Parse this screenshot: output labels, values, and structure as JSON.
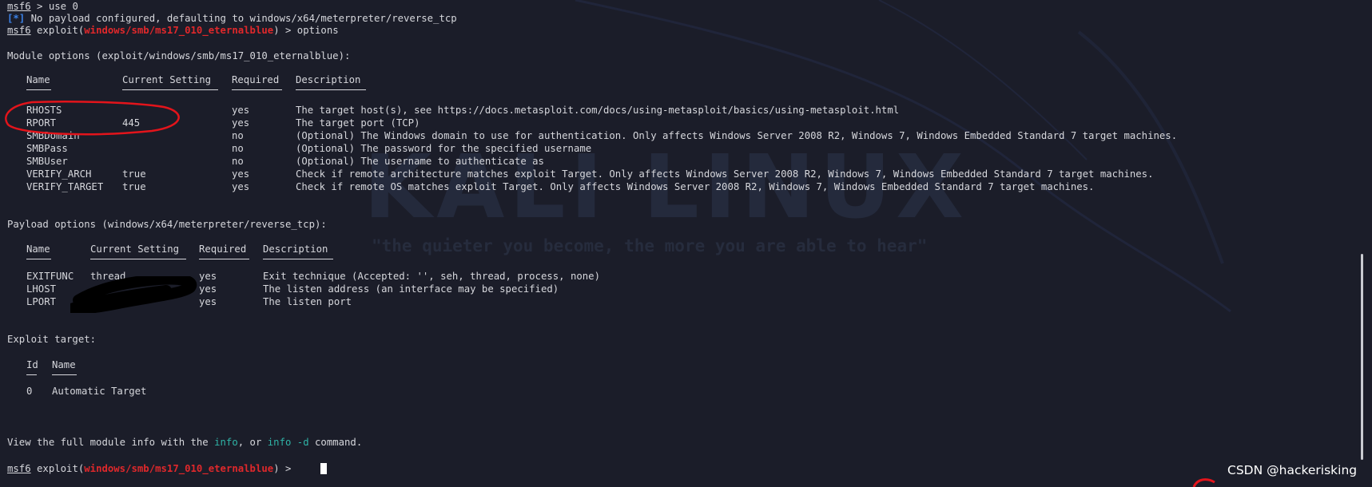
{
  "watermark": {
    "logo": "KALI LINUX",
    "quote": "\"the quieter you become, the more you are able to hear\""
  },
  "lines": {
    "l1_prompt": "msf6",
    "l1_cmd": " > use 0",
    "l2_tag": "[*]",
    "l2_text": " No payload configured, defaulting to windows/x64/meterpreter/reverse_tcp",
    "l3_prompt": "msf6",
    "l3_pre": " exploit(",
    "l3_module": "windows/smb/ms17_010_eternalblue",
    "l3_post": ") > options",
    "module_options_header": "Module options (exploit/windows/smb/ms17_010_eternalblue):",
    "payload_options_header": "Payload options (windows/x64/meterpreter/reverse_tcp):",
    "exploit_target_header": "Exploit target:",
    "info_pre": "View the full module info with the ",
    "info_cmd1": "info",
    "info_mid": ", or ",
    "info_cmd2": "info -d",
    "info_post": " command.",
    "last_prompt": "msf6",
    "last_pre": " exploit(",
    "last_module": "windows/smb/ms17_010_eternalblue",
    "last_post": ") > "
  },
  "module_table": {
    "headers": [
      "Name",
      "Current Setting",
      "Required",
      "Description"
    ],
    "rows": [
      [
        "RHOSTS",
        "",
        "yes",
        "The target host(s), see https://docs.metasploit.com/docs/using-metasploit/basics/using-metasploit.html"
      ],
      [
        "RPORT",
        "445",
        "yes",
        "The target port (TCP)"
      ],
      [
        "SMBDomain",
        "",
        "no",
        "(Optional) The Windows domain to use for authentication. Only affects Windows Server 2008 R2, Windows 7, Windows Embedded Standard 7 target machines."
      ],
      [
        "SMBPass",
        "",
        "no",
        "(Optional) The password for the specified username"
      ],
      [
        "SMBUser",
        "",
        "no",
        "(Optional) The username to authenticate as"
      ],
      [
        "VERIFY_ARCH",
        "true",
        "yes",
        "Check if remote architecture matches exploit Target. Only affects Windows Server 2008 R2, Windows 7, Windows Embedded Standard 7 target machines."
      ],
      [
        "VERIFY_TARGET",
        "true",
        "yes",
        "Check if remote OS matches exploit Target. Only affects Windows Server 2008 R2, Windows 7, Windows Embedded Standard 7 target machines."
      ]
    ]
  },
  "payload_table": {
    "headers": [
      "Name",
      "Current Setting",
      "Required",
      "Description"
    ],
    "rows": [
      [
        "EXITFUNC",
        "thread",
        "yes",
        "Exit technique (Accepted: '', seh, thread, process, none)"
      ],
      [
        "LHOST",
        "",
        "yes",
        "The listen address (an interface may be specified)"
      ],
      [
        "LPORT",
        "",
        "yes",
        "The listen port"
      ]
    ]
  },
  "target_table": {
    "headers": [
      "Id",
      "Name"
    ],
    "rows": [
      [
        "0",
        "Automatic Target"
      ]
    ]
  },
  "overlay": {
    "csdn_label": "CSDN @hackerisking"
  },
  "colors": {
    "background": "#1b1d29",
    "text": "#d6d7dc",
    "module_red": "#e0282b",
    "status_blue": "#3b82e8",
    "cmd_cyan": "#2fb3a6",
    "annotation_red": "#e3141b"
  }
}
